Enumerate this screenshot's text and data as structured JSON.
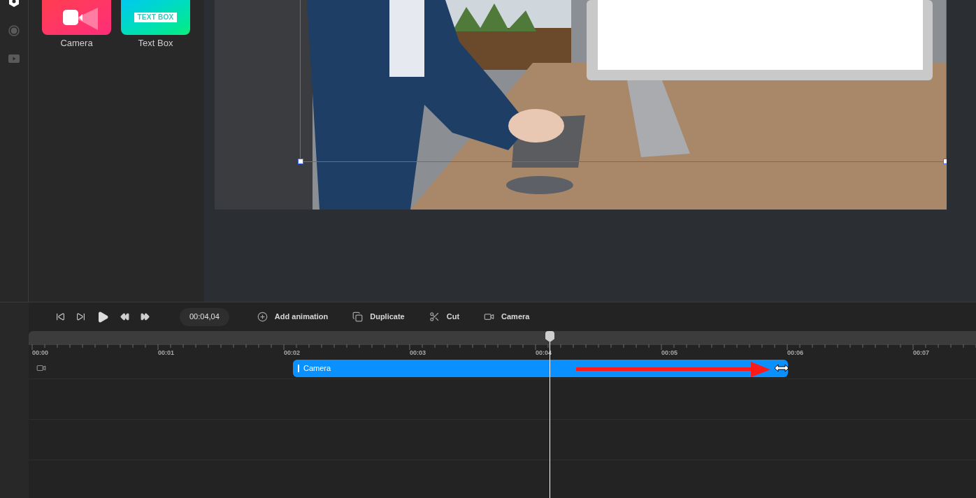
{
  "sidebar": {
    "items": [
      {
        "kind": "hexagon",
        "selected": true
      },
      {
        "kind": "record",
        "selected": false
      },
      {
        "kind": "video",
        "selected": false
      }
    ]
  },
  "panel": {
    "tiles": [
      {
        "kind": "camera",
        "label": "Camera"
      },
      {
        "kind": "textbox",
        "label": "Text Box",
        "tile_text": "TEXT BOX"
      }
    ]
  },
  "toolbar": {
    "transport": [
      {
        "kind": "skip-start"
      },
      {
        "kind": "step-forward"
      },
      {
        "kind": "play"
      },
      {
        "kind": "rewind"
      },
      {
        "kind": "forward"
      }
    ],
    "time": "00:04,04",
    "actions": [
      {
        "kind": "add",
        "label": "Add animation"
      },
      {
        "kind": "duplicate",
        "label": "Duplicate"
      },
      {
        "kind": "cut",
        "label": "Cut"
      },
      {
        "kind": "camera",
        "label": "Camera"
      }
    ]
  },
  "timeline": {
    "ticks": [
      "00:00",
      "00:01",
      "00:02",
      "00:03",
      "00:04",
      "00:05",
      "00:06",
      "00:07"
    ],
    "tracks": [
      {
        "kind": "camera",
        "clip": "Camera"
      }
    ]
  }
}
